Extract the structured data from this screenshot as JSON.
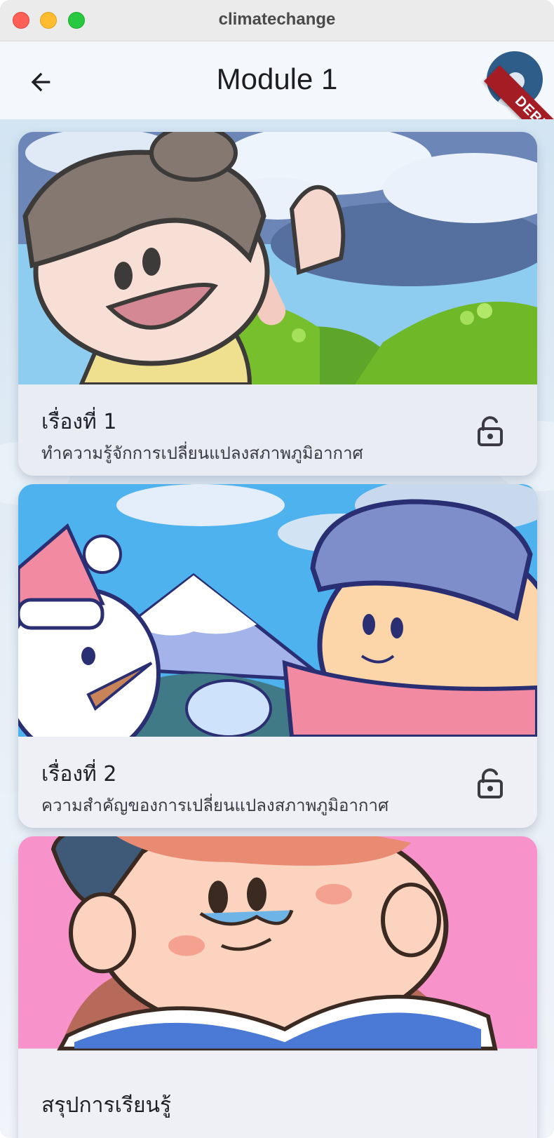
{
  "window": {
    "title": "climatechange"
  },
  "appbar": {
    "title": "Module 1",
    "debug_label": "DEBUG",
    "icons": {
      "back": "arrow-left-icon",
      "avatar": "person-icon"
    }
  },
  "cards": [
    {
      "title": "เรื่องที่ 1",
      "subtitle": "ทำความรู้จักการเปลี่ยนแปลงสภาพภูมิอากาศ",
      "status_icon": "unlock-icon",
      "image": "girl-waving-hills-illustration"
    },
    {
      "title": "เรื่องที่ 2",
      "subtitle": "ความสำคัญของการเปลี่ยนแปลงสภาพภูมิอากาศ",
      "status_icon": "unlock-icon",
      "image": "boy-snowman-mountain-illustration"
    },
    {
      "title": "สรุปการเรียนรู้",
      "subtitle": "",
      "status_icon": "",
      "image": "boy-reading-book-illustration"
    }
  ],
  "colors": {
    "debug_ribbon": "#a51d24",
    "avatar": "#2f5d8a",
    "card_info": "#e9ecf3"
  }
}
